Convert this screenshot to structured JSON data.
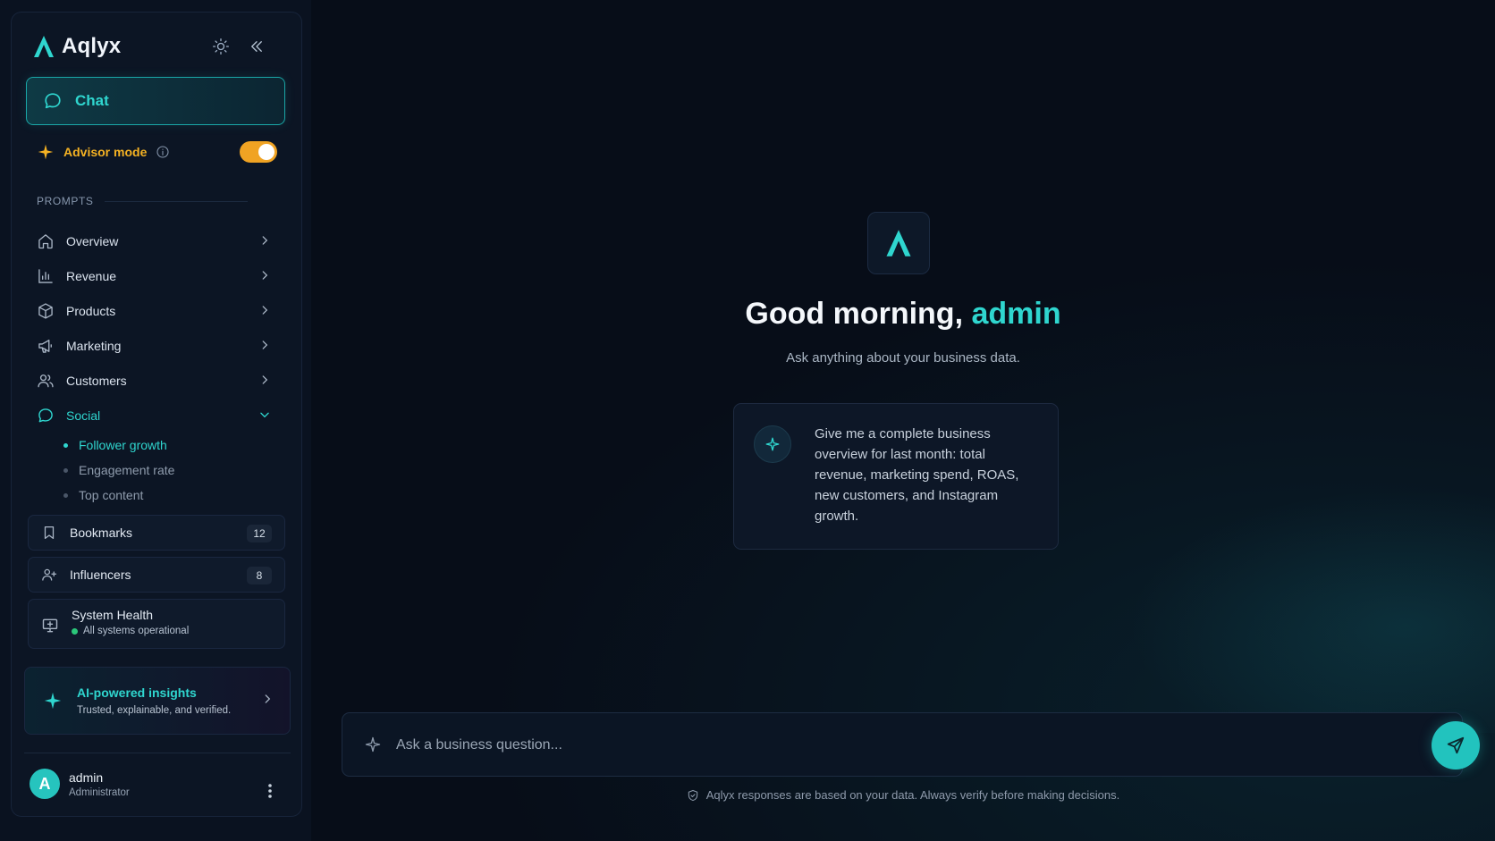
{
  "brand": {
    "name": "Aqlyx"
  },
  "sidebar": {
    "chat_label": "Chat",
    "advisor_label": "Advisor mode",
    "advisor_enabled": true,
    "section_label": "PROMPTS",
    "nav": [
      {
        "label": "Overview",
        "icon": "home-icon"
      },
      {
        "label": "Revenue",
        "icon": "bar-chart-icon"
      },
      {
        "label": "Products",
        "icon": "box-icon"
      },
      {
        "label": "Marketing",
        "icon": "megaphone-icon"
      },
      {
        "label": "Customers",
        "icon": "users-icon"
      },
      {
        "label": "Social",
        "icon": "chat-bubble-icon",
        "expanded": true
      }
    ],
    "social_sub": [
      "Follower growth",
      "Engagement rate",
      "Top content"
    ],
    "bookmarks": {
      "label": "Bookmarks",
      "count": "12"
    },
    "influencers": {
      "label": "Influencers",
      "count": "8"
    },
    "health": {
      "title": "System Health",
      "status": "All systems operational"
    },
    "insights": {
      "title": "AI-powered insights",
      "subtitle": "Trusted, explainable, and verified."
    },
    "user": {
      "initial": "A",
      "name": "admin",
      "role": "Administrator"
    }
  },
  "main": {
    "greeting_prefix": "Good morning, ",
    "greeting_name": "admin",
    "tagline": "Ask anything about your business data.",
    "suggestion": "Give me a complete business overview for last month: total revenue, marketing spend, ROAS, new customers, and Instagram growth.",
    "composer_placeholder": "Ask a business question...",
    "disclaimer": "Aqlyx responses are based on your data. Always verify before making decisions."
  },
  "colors": {
    "accent": "#2fd6cf",
    "advisor": "#f5b223",
    "background": "#070d18",
    "status_ok": "#2bc77a"
  }
}
